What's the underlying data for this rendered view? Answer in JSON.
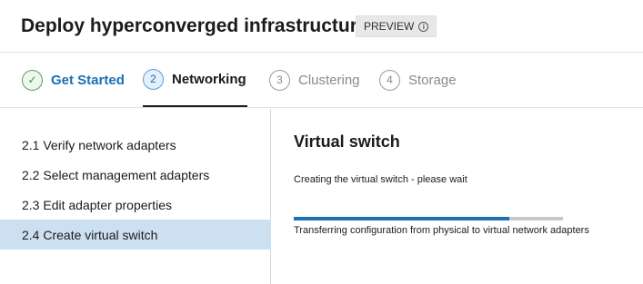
{
  "header": {
    "title": "Deploy hyperconverged infrastructure",
    "badge": "PREVIEW",
    "badge_icon": "info-icon",
    "badge_icon_glyph": "i"
  },
  "steps": [
    {
      "number": "✓",
      "label": "Get Started",
      "state": "completed",
      "icon": "check-icon"
    },
    {
      "number": "2",
      "label": "Networking",
      "state": "active"
    },
    {
      "number": "3",
      "label": "Clustering",
      "state": "inactive"
    },
    {
      "number": "4",
      "label": "Storage",
      "state": "inactive"
    }
  ],
  "sidebar": {
    "items": [
      {
        "label": "2.1  Verify network adapters",
        "selected": false
      },
      {
        "label": "2.2  Select management adapters",
        "selected": false
      },
      {
        "label": "2.3  Edit adapter properties",
        "selected": false
      },
      {
        "label": "2.4  Create virtual switch",
        "selected": true
      }
    ]
  },
  "main": {
    "title": "Virtual switch",
    "status": "Creating the virtual switch - please wait",
    "progress": 0.8,
    "progress_caption": "Transferring configuration from physical to virtual network adapters"
  },
  "colors": {
    "accent": "#1a6fb5",
    "selected_bg": "#cde0f2",
    "completed": "#3f8f3f",
    "inactive": "#8a8a8a",
    "track": "#c8c8c8"
  }
}
